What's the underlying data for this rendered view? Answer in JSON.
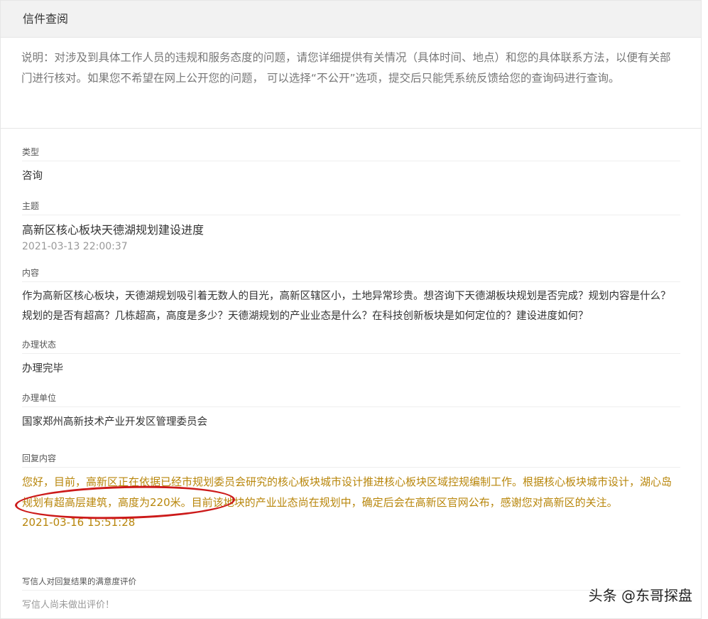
{
  "header": {
    "title": "信件查阅"
  },
  "notice": {
    "text": "说明：对涉及到具体工作人员的违规和服务态度的问题，请您详细提供有关情况（具体时间、地点）和您的具体联系方法，以便有关部门进行核对。如果您不希望在网上公开您的问题， 可以选择“不公开”选项，提交后只能凭系统反馈给您的查询码进行查询。"
  },
  "fields": {
    "type": {
      "label": "类型",
      "value": "咨询"
    },
    "subject": {
      "label": "主题",
      "value": "高新区核心板块天德湖规划建设进度",
      "time": "2021-03-13 22:00:37"
    },
    "content": {
      "label": "内容",
      "value": "作为高新区核心板块，天德湖规划吸引着无数人的目光，高新区辖区小，土地异常珍贵。想咨询下天德湖板块规划是否完成？规划内容是什么？规划的是否有超高？几栋超高，高度是多少？天德湖规划的产业业态是什么？在科技创新板块是如何定位的？建设进度如何？"
    },
    "status": {
      "label": "办理状态",
      "value": "办理完毕"
    },
    "unit": {
      "label": "办理单位",
      "value": "国家郑州高新技术产业开发区管理委员会"
    },
    "reply": {
      "label": "回复内容",
      "value": "您好，目前，高新区正在依据已经市规划委员会研究的核心板块城市设计推进核心板块区域控规编制工作。根据核心板块城市设计，湖心岛规划有超高层建筑，高度为220米。目前该地块的产业业态尚在规划中，确定后会在高新区官网公布，感谢您对高新区的关注。",
      "time": "2021-03-16 15:51:28"
    },
    "rating": {
      "label": "写信人对回复结果的满意度评价",
      "value": "写信人尚未做出评价！"
    }
  },
  "watermark": {
    "text": "头条 @东哥探盘"
  },
  "colors": {
    "reply_text": "#b8860b",
    "highlight_circle": "#cc1a1a",
    "header_bg": "#f2f2f2"
  }
}
